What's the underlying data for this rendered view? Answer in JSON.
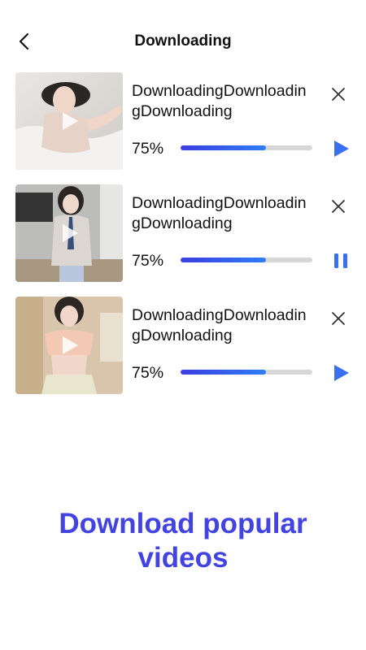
{
  "header": {
    "title": "Downloading",
    "back_icon": "chevron-left-icon"
  },
  "colors": {
    "accent": "#3A6FF0",
    "progress_start": "#3A3EE0",
    "progress_end": "#2F7DF5",
    "track": "#D7D7D7",
    "promo_text": "#4343E2"
  },
  "downloads": [
    {
      "name": "DownloadingDownloadingDownloading",
      "progress_label": "75%",
      "progress": 0.65,
      "state": "paused",
      "action_icon": "play-icon",
      "close_icon": "close-icon"
    },
    {
      "name": "DownloadingDownloadingDownloading",
      "progress_label": "75%",
      "progress": 0.65,
      "state": "downloading",
      "action_icon": "pause-icon",
      "close_icon": "close-icon"
    },
    {
      "name": "DownloadingDownloadingDownloading",
      "progress_label": "75%",
      "progress": 0.65,
      "state": "paused",
      "action_icon": "play-icon",
      "close_icon": "close-icon"
    }
  ],
  "promo": {
    "line1": "Download popular",
    "line2": "videos"
  }
}
